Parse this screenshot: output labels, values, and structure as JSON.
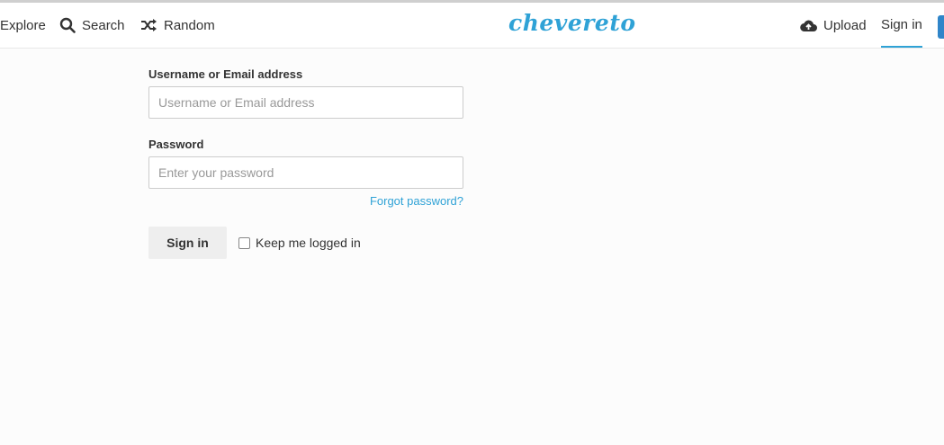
{
  "nav": {
    "explore": {
      "label": "Explore",
      "icon": "explore-icon"
    },
    "search": {
      "label": "Search",
      "icon": "search-icon"
    },
    "random": {
      "label": "Random",
      "icon": "shuffle-icon"
    },
    "upload": {
      "label": "Upload",
      "icon": "cloud-upload-icon"
    },
    "signin": {
      "label": "Sign in"
    }
  },
  "brand": {
    "logo_text": "chevereto",
    "color": "#2fa2d6"
  },
  "form": {
    "username": {
      "label": "Username or Email address",
      "placeholder": "Username or Email address",
      "value": ""
    },
    "password": {
      "label": "Password",
      "placeholder": "Enter your password",
      "value": ""
    },
    "forgot_label": "Forgot password?",
    "submit_label": "Sign in",
    "keep_logged_label": "Keep me logged in",
    "keep_logged_checked": false
  },
  "colors": {
    "accent": "#2fa2d6",
    "edge_button": "#2f85c9"
  }
}
